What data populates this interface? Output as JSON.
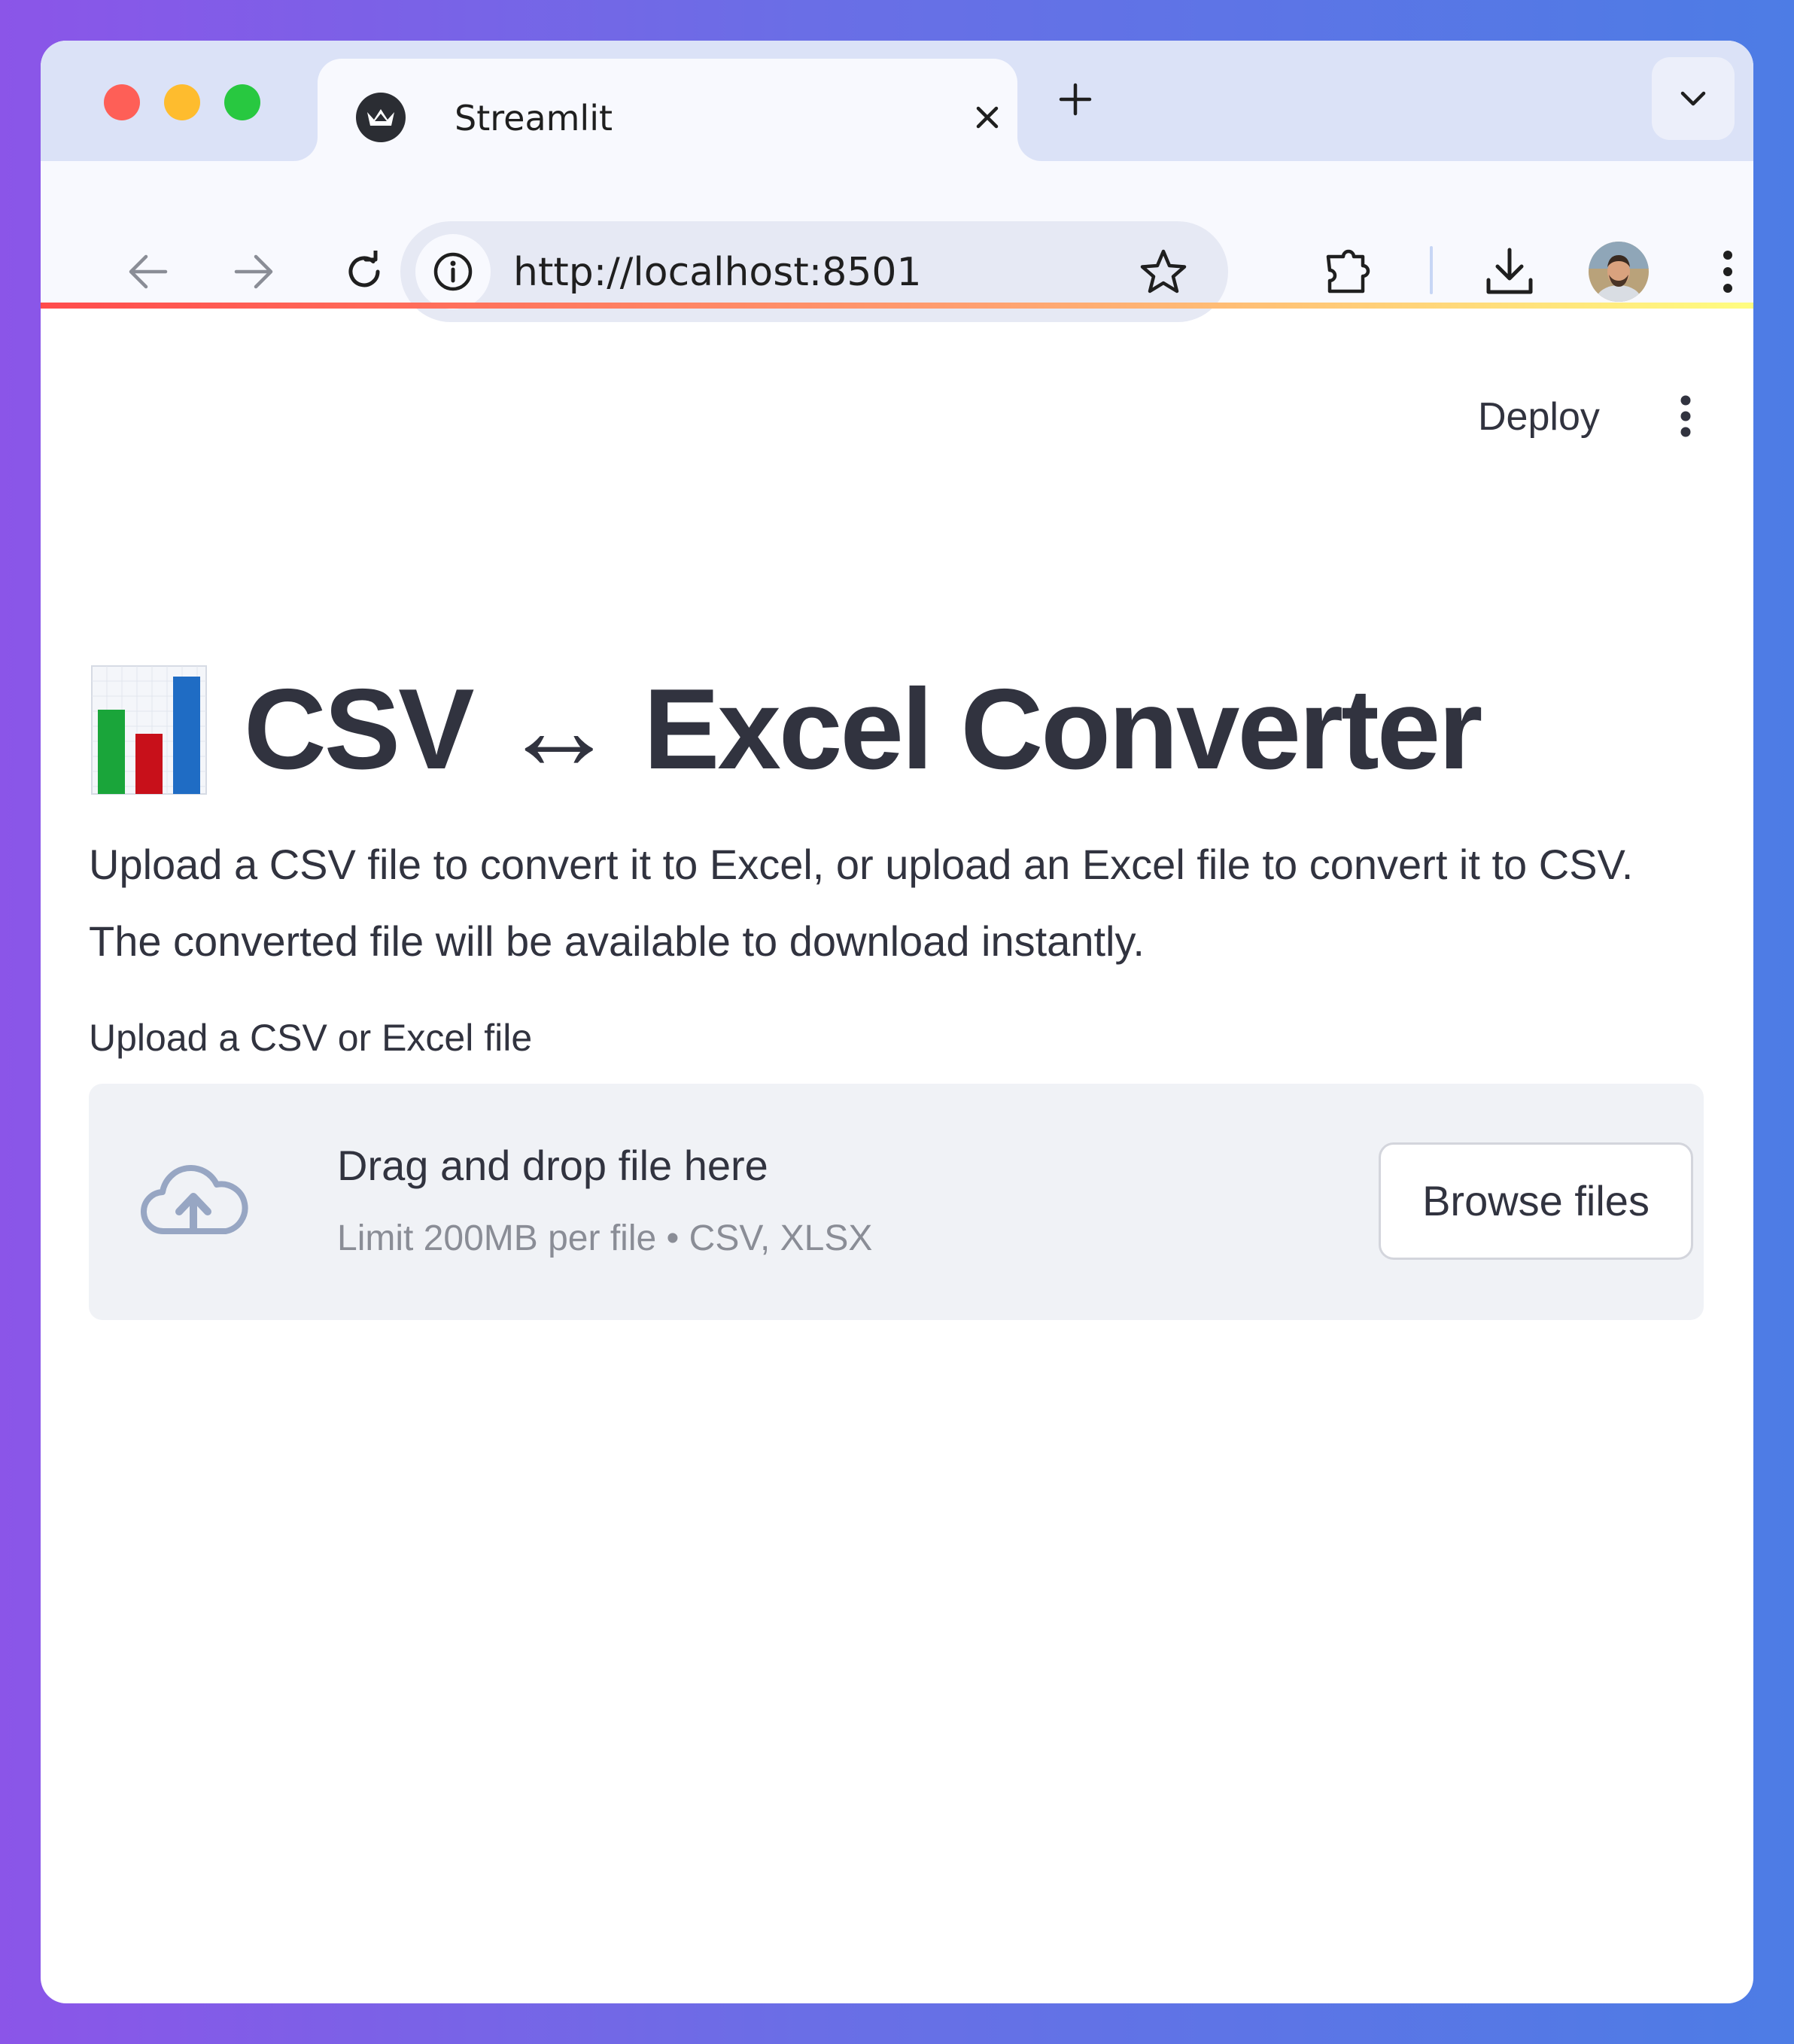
{
  "browser": {
    "tab_title": "Streamlit",
    "url": "http://localhost:8501"
  },
  "app": {
    "deploy_label": "Deploy",
    "title": "CSV ↔ Excel Converter",
    "title_icon": "bar-chart-icon",
    "description": "Upload a CSV file to convert it to Excel, or upload an Excel file to convert it to CSV. The converted file will be available to download instantly.",
    "uploader": {
      "label": "Upload a CSV or Excel file",
      "drag_text": "Drag and drop file here",
      "limit_text": "Limit 200MB per file • CSV, XLSX",
      "browse_label": "Browse files"
    }
  },
  "colors": {
    "accent_red": "#ff4b4b",
    "text": "#31333f",
    "dropzone_bg": "#f0f2f6"
  }
}
